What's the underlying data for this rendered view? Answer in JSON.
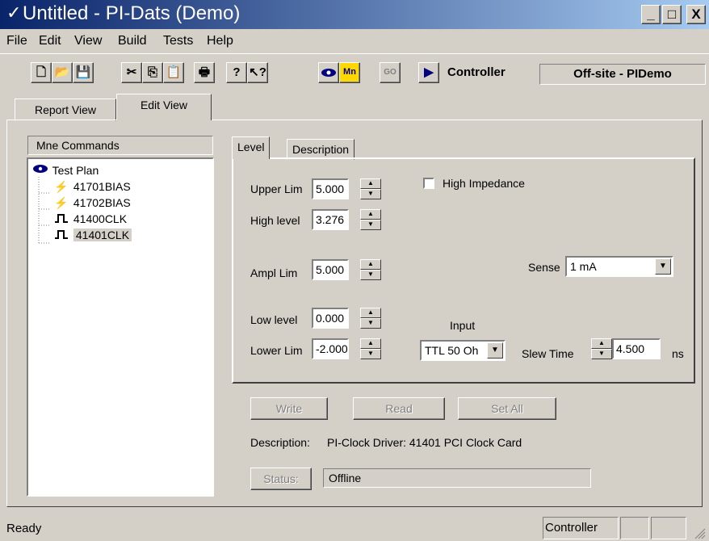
{
  "window": {
    "title": "Untitled - PI-Dats (Demo)",
    "minimize": "_",
    "maximize": "□",
    "close": "X"
  },
  "menu": {
    "items": [
      {
        "label": "File"
      },
      {
        "label": "Edit"
      },
      {
        "label": "View"
      },
      {
        "label": "Build"
      },
      {
        "label": "Tests"
      },
      {
        "label": "Help"
      }
    ]
  },
  "toolbar": {
    "icons": [
      "new-file-icon",
      "open-folder-icon",
      "save-icon",
      "cut-icon",
      "copy-icon",
      "paste-icon",
      "print-icon",
      "help-icon",
      "context-help-icon",
      "view-eye-icon",
      "mnemonic-icon",
      "go-icon",
      "run-icon"
    ],
    "mn_label": "Mn",
    "go_label": "GO",
    "controller_label": "Controller",
    "site_label": "Off-site - PIDemo"
  },
  "tabs": {
    "report_view": "Report View",
    "edit_view": "Edit View"
  },
  "tree": {
    "header": "Mne Commands",
    "root": "Test Plan",
    "items": [
      {
        "label": "41701BIAS",
        "icon": "bias-icon"
      },
      {
        "label": "41702BIAS",
        "icon": "bias-icon"
      },
      {
        "label": "41400CLK",
        "icon": "clock-icon"
      },
      {
        "label": "41401CLK",
        "icon": "clock-icon",
        "selected": true
      }
    ]
  },
  "inner_tabs": {
    "level": "Level",
    "description": "Description"
  },
  "level": {
    "upper_lim_label": "Upper Lim",
    "upper_lim": "5.000",
    "high_level_label": "High level",
    "high_level": "3.276",
    "ampl_lim_label": "Ampl Lim",
    "ampl_lim": "5.000",
    "low_level_label": "Low level",
    "low_level": "0.000",
    "lower_lim_label": "Lower Lim",
    "lower_lim": "-2.000",
    "high_impedance_label": "High Impedance",
    "high_impedance_checked": false,
    "sense_label": "Sense",
    "sense_value": "1 mA",
    "input_label": "Input",
    "input_value": "TTL 50 Oh",
    "slew_time_label": "Slew Time",
    "slew_time": "4.500",
    "slew_unit": "ns"
  },
  "actions": {
    "write": "Write",
    "read": "Read",
    "set_all": "Set All",
    "description_label": "Description:",
    "description_value": "PI-Clock Driver: 41401 PCI Clock Card",
    "status_button": "Status:",
    "status_value": "Offline"
  },
  "statusbar": {
    "ready": "Ready",
    "controller": "Controller"
  }
}
